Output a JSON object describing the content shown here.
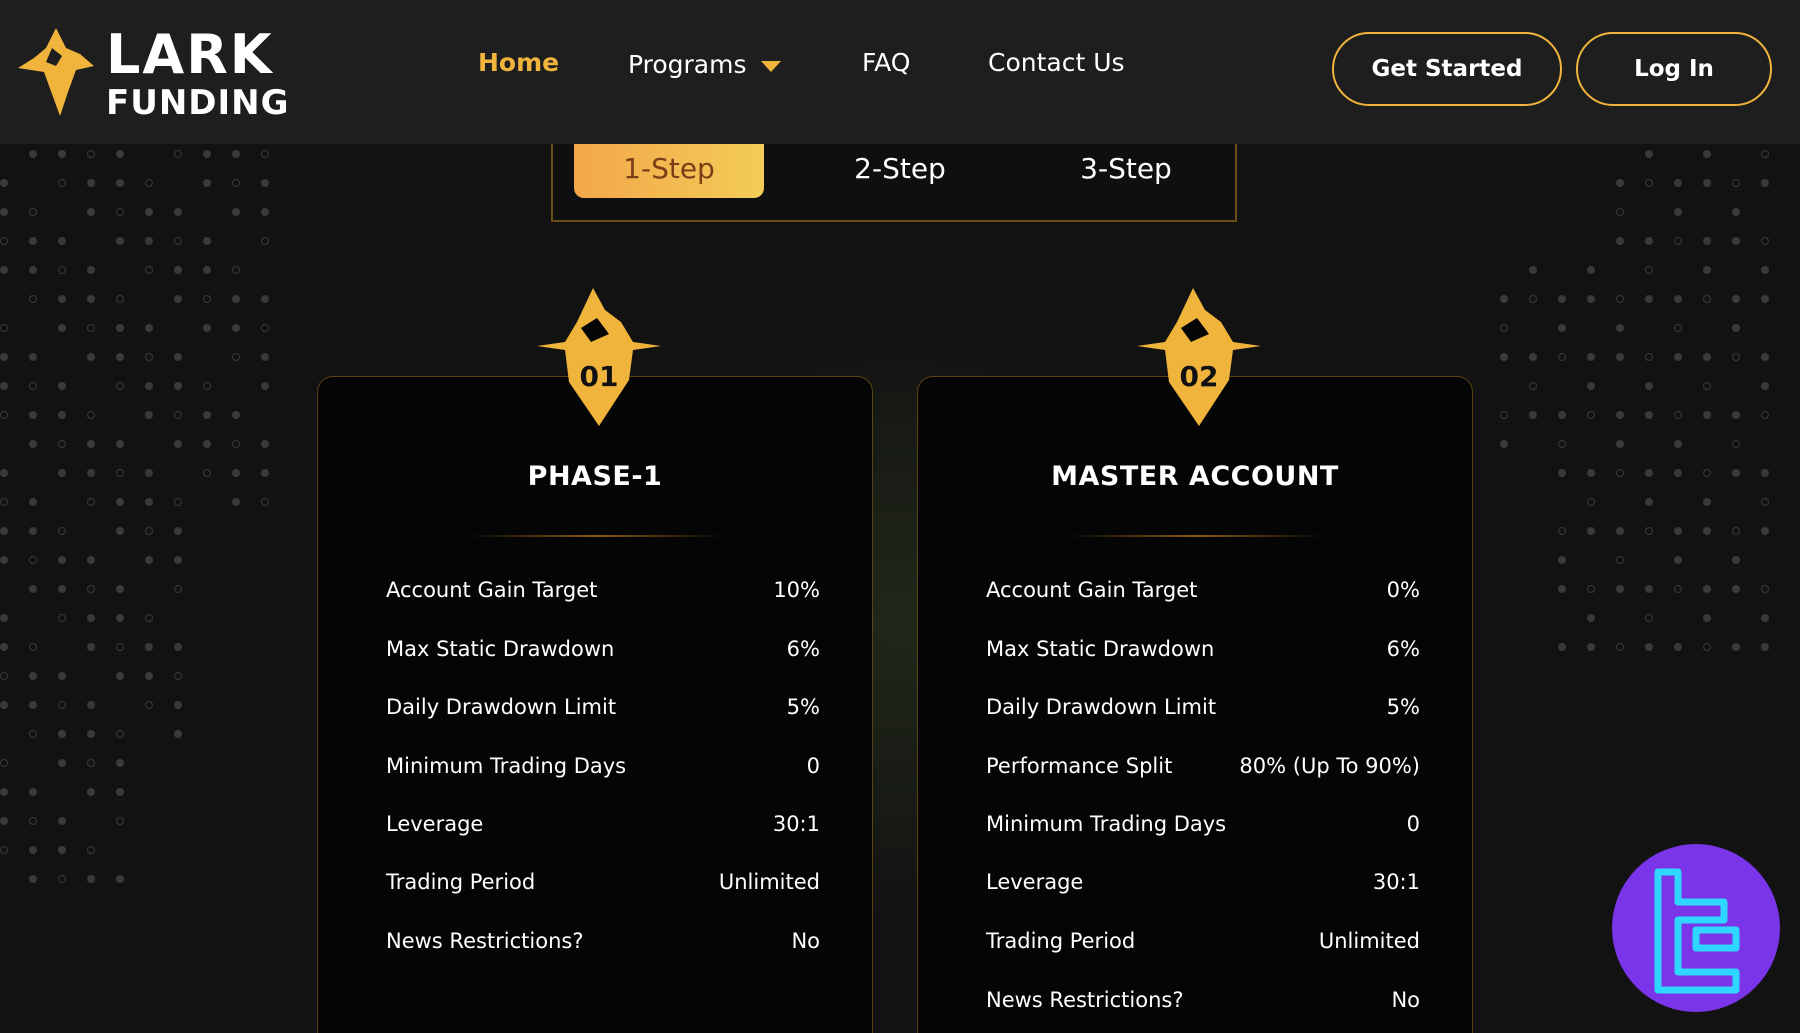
{
  "brand": {
    "line1": "LARK",
    "line2": "FUNDING",
    "accent_color": "#f0b43c",
    "logo_icon": "lark-flame-icon"
  },
  "nav": {
    "items": [
      {
        "label": "Home",
        "active": true
      },
      {
        "label": "Programs",
        "has_dropdown": true,
        "dropdown_icon": "caret-down-icon"
      },
      {
        "label": "FAQ"
      },
      {
        "label": "Contact Us"
      }
    ],
    "get_started": "Get Started",
    "log_in": "Log In"
  },
  "steps": {
    "tabs": [
      "1-Step",
      "2-Step",
      "3-Step"
    ],
    "active_index": 0
  },
  "cards": [
    {
      "badge_number": "01",
      "title": "PHASE-1",
      "rows": [
        {
          "label": "Account Gain Target",
          "value": "10%"
        },
        {
          "label": "Max Static Drawdown",
          "value": "6%"
        },
        {
          "label": "Daily Drawdown Limit",
          "value": "5%"
        },
        {
          "label": "Minimum Trading Days",
          "value": "0"
        },
        {
          "label": "Leverage",
          "value": "30:1"
        },
        {
          "label": "Trading Period",
          "value": "Unlimited"
        },
        {
          "label": "News Restrictions?",
          "value": "No"
        }
      ]
    },
    {
      "badge_number": "02",
      "title": "MASTER ACCOUNT",
      "rows": [
        {
          "label": "Account Gain Target",
          "value": "0%"
        },
        {
          "label": "Max Static Drawdown",
          "value": "6%"
        },
        {
          "label": "Daily Drawdown Limit",
          "value": "5%"
        },
        {
          "label": "Performance Split",
          "value": "80% (Up To 90%)"
        },
        {
          "label": "Minimum Trading Days",
          "value": "0"
        },
        {
          "label": "Leverage",
          "value": "30:1"
        },
        {
          "label": "Trading Period",
          "value": "Unlimited"
        },
        {
          "label": "News Restrictions?",
          "value": "No"
        }
      ]
    }
  ],
  "watermark": {
    "icon": "tc-logo-icon",
    "color": "#7b35e8"
  }
}
